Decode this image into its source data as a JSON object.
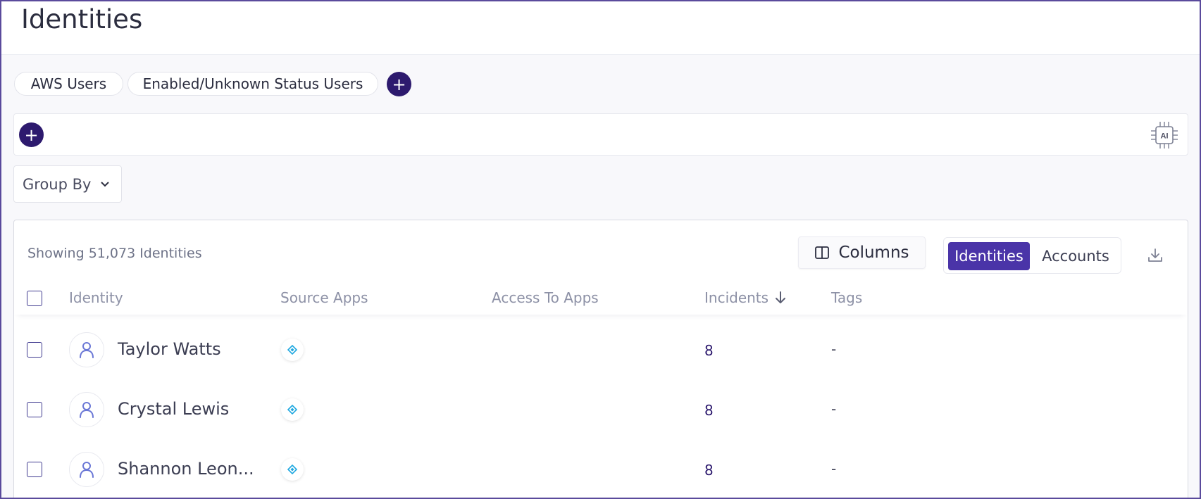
{
  "page": {
    "title": "Identities"
  },
  "saved_filters": {
    "items": [
      {
        "label": "AWS Users"
      },
      {
        "label": "Enabled/Unknown Status Users"
      }
    ],
    "add_symbol": "+"
  },
  "filter_bar": {
    "add_symbol": "+",
    "ai_label": "AI"
  },
  "group_by": {
    "label": "Group By"
  },
  "table_card": {
    "showing_text": "Showing 51,073 Identities",
    "columns_button_label": "Columns",
    "view_toggle": [
      {
        "label": "Identities",
        "active": true
      },
      {
        "label": "Accounts",
        "active": false
      }
    ],
    "headers": {
      "identity": "Identity",
      "source_apps": "Source Apps",
      "access_to_apps": "Access To Apps",
      "incidents": "Incidents",
      "tags": "Tags"
    },
    "sort": {
      "column": "Incidents",
      "direction": "descending",
      "icon": "arrow-down-icon"
    },
    "rows": [
      {
        "name": "Taylor Watts",
        "source_app_icon": "app-logo-icon",
        "incidents": "8",
        "tags": "-"
      },
      {
        "name": "Crystal Lewis",
        "source_app_icon": "app-logo-icon",
        "incidents": "8",
        "tags": "-"
      },
      {
        "name": "Shannon Leon...",
        "source_app_icon": "app-logo-icon",
        "incidents": "8",
        "tags": "-"
      }
    ]
  },
  "colors": {
    "accent": "#2d1a6e",
    "active_toggle": "#4a34a8",
    "frame_border": "#5a4a9c",
    "app_icon": "#1fa8e0",
    "avatar_icon": "#6b78d6"
  }
}
